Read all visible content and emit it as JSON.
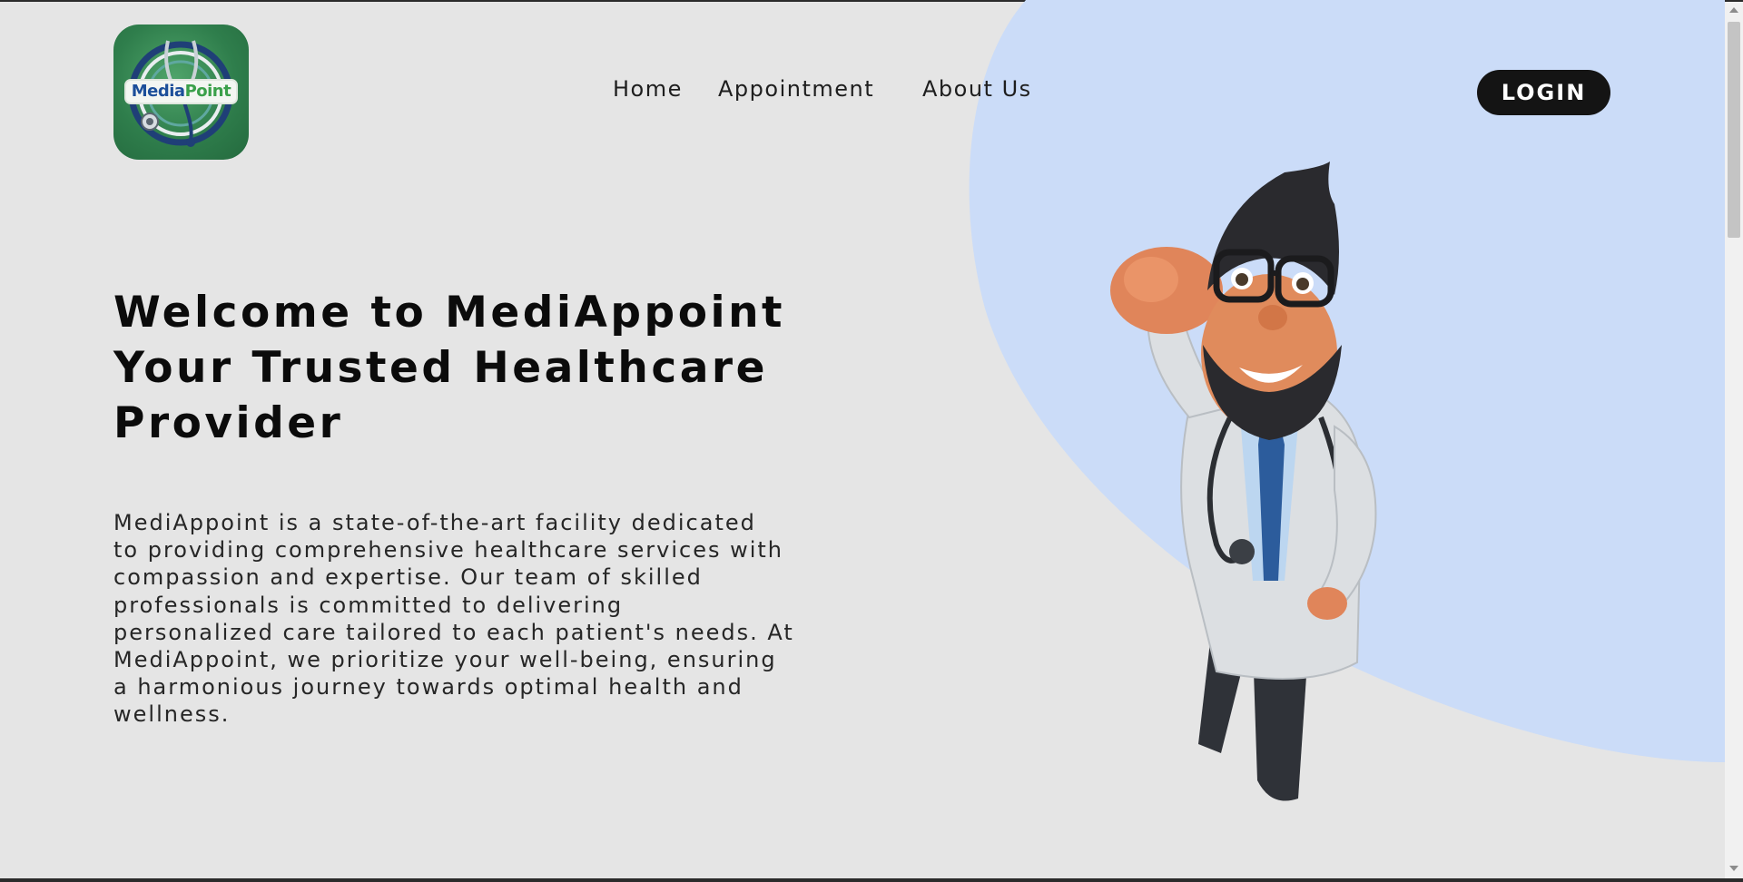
{
  "brand": {
    "logo_text_part1": "Media",
    "logo_text_part2": "Point",
    "logo_bg_color": "#2f7e4c"
  },
  "nav": {
    "items": [
      {
        "label": "Home"
      },
      {
        "label": "Appointment"
      },
      {
        "label": "About Us"
      }
    ],
    "login_label": "LOGIN"
  },
  "hero": {
    "headline_lines": [
      "Welcome to MediAppoint",
      "Your Trusted Healthcare",
      "Provider"
    ],
    "description_lines": [
      "MediAppoint is a state-of-the-art facility dedicated",
      "to providing comprehensive healthcare services with",
      "compassion and expertise. Our team of skilled",
      "professionals is committed to delivering",
      "personalized care tailored to each patient's needs. At",
      "MediAppoint, we prioritize your well-being, ensuring",
      "a harmonious journey towards optimal health and",
      "wellness."
    ],
    "accent_color": "#cbdcf8",
    "illustration": "cartoon-doctor-flying-icon"
  },
  "colors": {
    "background": "#e5e5e5",
    "button_bg": "#141414",
    "button_text": "#ffffff",
    "text": "#0b0b0b"
  }
}
